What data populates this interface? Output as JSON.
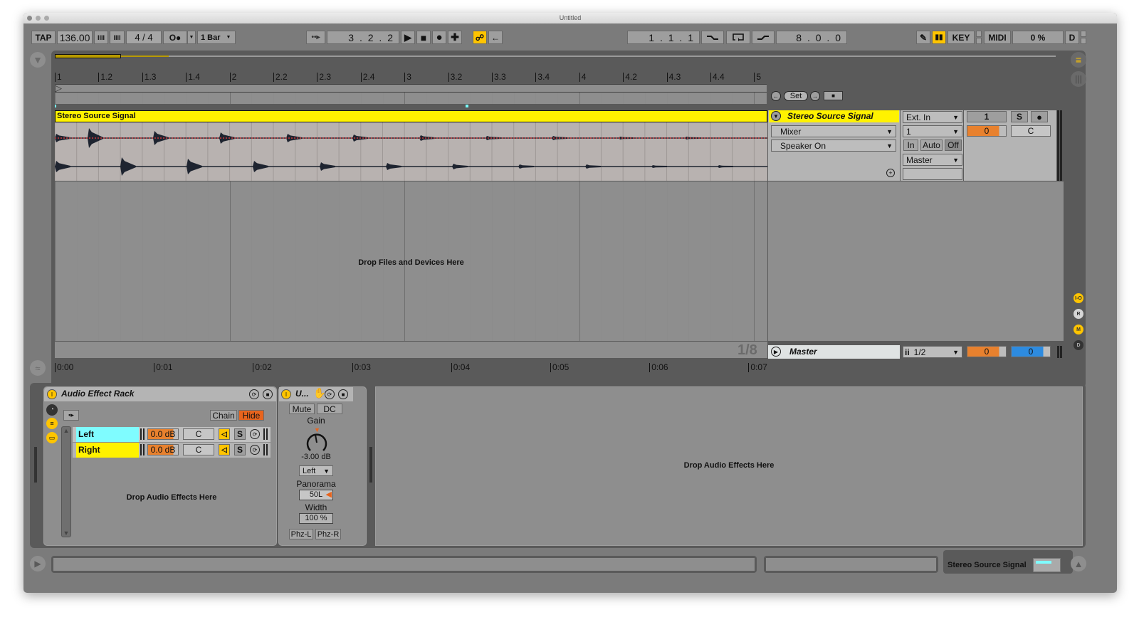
{
  "window": {
    "title": "Untitled"
  },
  "control_bar": {
    "tap": "TAP",
    "tempo": "136.00",
    "nudge_down": "IIII",
    "nudge_up": "IIII",
    "time_signature": "4  /  4",
    "metronome": "O●",
    "quantization": "1 Bar",
    "follow": "••▸",
    "position": "3 .  2 .  2",
    "play": "▶",
    "stop": "■",
    "record": "●",
    "overdub": "✚",
    "automation_arm": "☍",
    "back_to_arrangement": "←",
    "loop_start": "1 .  1 .  1",
    "punch_in": "⎾",
    "loop": "↵",
    "punch_out": "⎿",
    "loop_length": "8 .  0 .  0",
    "draw_mode": "✎",
    "key": "KEY",
    "midi": "MIDI",
    "cpu": "0 %",
    "disk": "D"
  },
  "arrangement": {
    "bar_ruler": [
      "1",
      "1.2",
      "1.3",
      "1.4",
      "2",
      "2.2",
      "2.3",
      "2.4",
      "3",
      "3.2",
      "3.3",
      "3.4",
      "4",
      "4.2",
      "4.3",
      "4.4",
      "5"
    ],
    "time_ruler": [
      "0:00",
      "0:01",
      "0:02",
      "0:03",
      "0:04",
      "0:05",
      "0:06",
      "0:07"
    ],
    "locator": {
      "prev": "←",
      "set": "Set",
      "next": "→"
    },
    "clip_name": "Stereo Source Signal",
    "drop_text": "Drop Files and Devices Here",
    "grid_label": "1/8"
  },
  "track": {
    "name": "Stereo Source Signal",
    "audio_from": "Ext. In",
    "input_channel": "1",
    "monitor": [
      "In",
      "Auto",
      "Off"
    ],
    "audio_to": "Master",
    "output_type": "Mixer",
    "output_channel": "Speaker On",
    "track_number": "1",
    "solo": "S",
    "arm": "●",
    "volume": "0",
    "pan": "C"
  },
  "master": {
    "name": "Master",
    "cue_out": "1/2",
    "volume": "0",
    "preview_volume": "0"
  },
  "side_buttons": [
    "I-O",
    "R",
    "M",
    "D"
  ],
  "rack": {
    "title": "Audio Effect Rack",
    "chain_btn": "Chain",
    "hide_btn": "Hide",
    "chains": [
      {
        "name": "Left",
        "volume": "0.0 dB",
        "pan": "C",
        "solo": "S",
        "color": "#7ffcff"
      },
      {
        "name": "Right",
        "volume": "0.0 dB",
        "pan": "C",
        "solo": "S",
        "color": "#fff200"
      }
    ],
    "drop_text": "Drop Audio Effects Here"
  },
  "utility": {
    "title": "U...",
    "mute": "Mute",
    "dc": "DC",
    "gain_label": "Gain",
    "gain_value": "-3.00 dB",
    "channel_mode": "Left",
    "panorama_label": "Panorama",
    "panorama": "50L",
    "width_label": "Width",
    "width": "100 %",
    "phz_l": "Phz-L",
    "phz_r": "Phz-R"
  },
  "device_drop_text": "Drop Audio Effects Here",
  "status_bar": {
    "track_name": "Stereo Source Signal"
  },
  "colors": {
    "clip": "#fff200",
    "accent": "#ffc400",
    "orange": "#e8812e",
    "blue": "#2d8be0",
    "cyan": "#7ffcff"
  }
}
